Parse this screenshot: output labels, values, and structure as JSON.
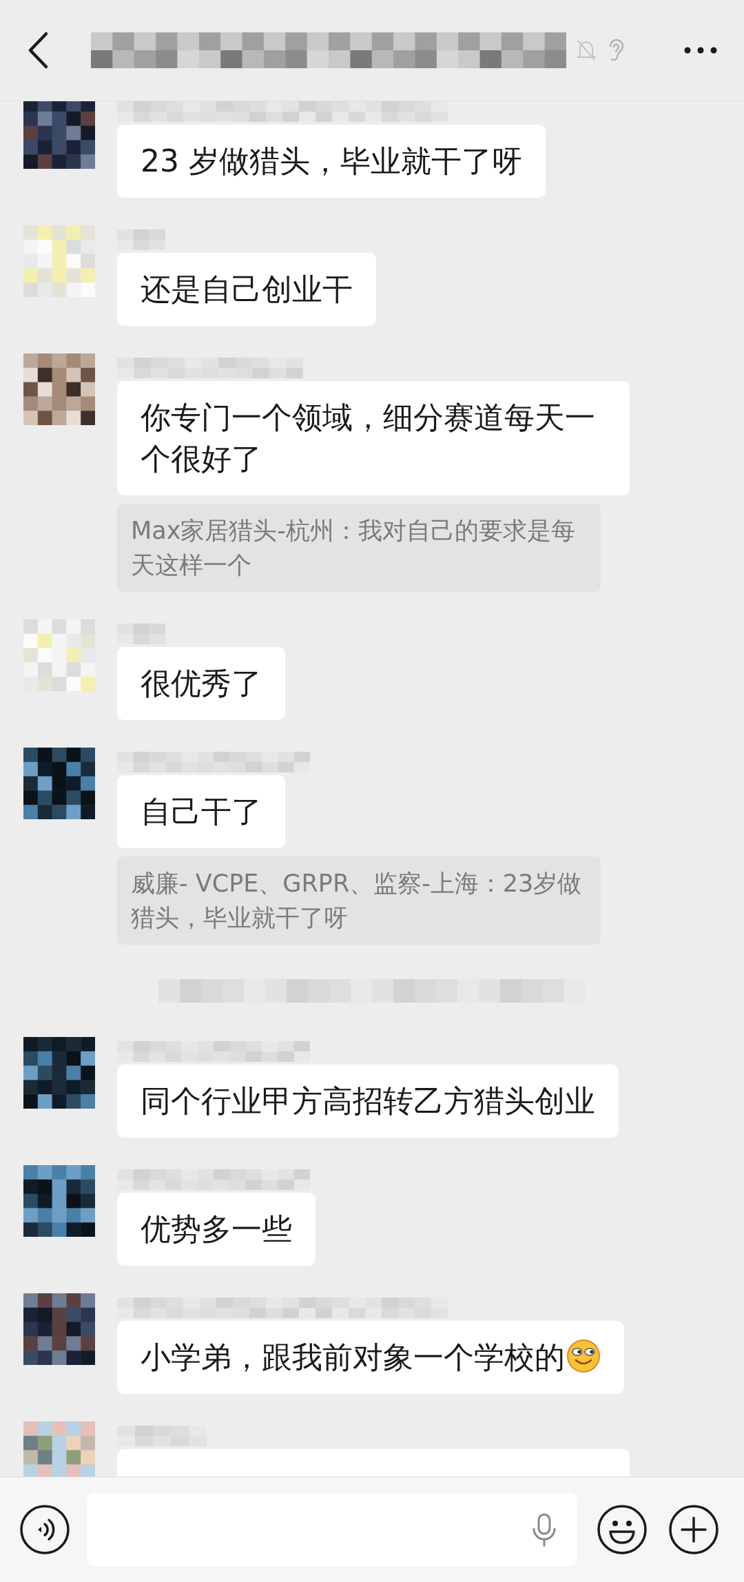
{
  "messages": [
    {
      "kind": "message",
      "text": "23 岁做猎头，毕业就干了呀"
    },
    {
      "kind": "message",
      "text": "还是自己创业干"
    },
    {
      "kind": "message",
      "text": "你专门一个领域，细分赛道每天一个很好了",
      "quote": "Max家居猎头-杭州：我对自己的要求是每天这样一个"
    },
    {
      "kind": "message",
      "text": "很优秀了"
    },
    {
      "kind": "message",
      "text": "自己干了",
      "quote": "威廉- VCPE、GRPR、监察-上海：23岁做猎头，毕业就干了呀"
    },
    {
      "kind": "system"
    },
    {
      "kind": "message",
      "text": "同个行业甲方高招转乙方猎头创业"
    },
    {
      "kind": "message",
      "text": "优势多一些"
    },
    {
      "kind": "message",
      "text": "小学弟，跟我前对象一个学校的",
      "emoji": true
    },
    {
      "kind": "message"
    }
  ]
}
